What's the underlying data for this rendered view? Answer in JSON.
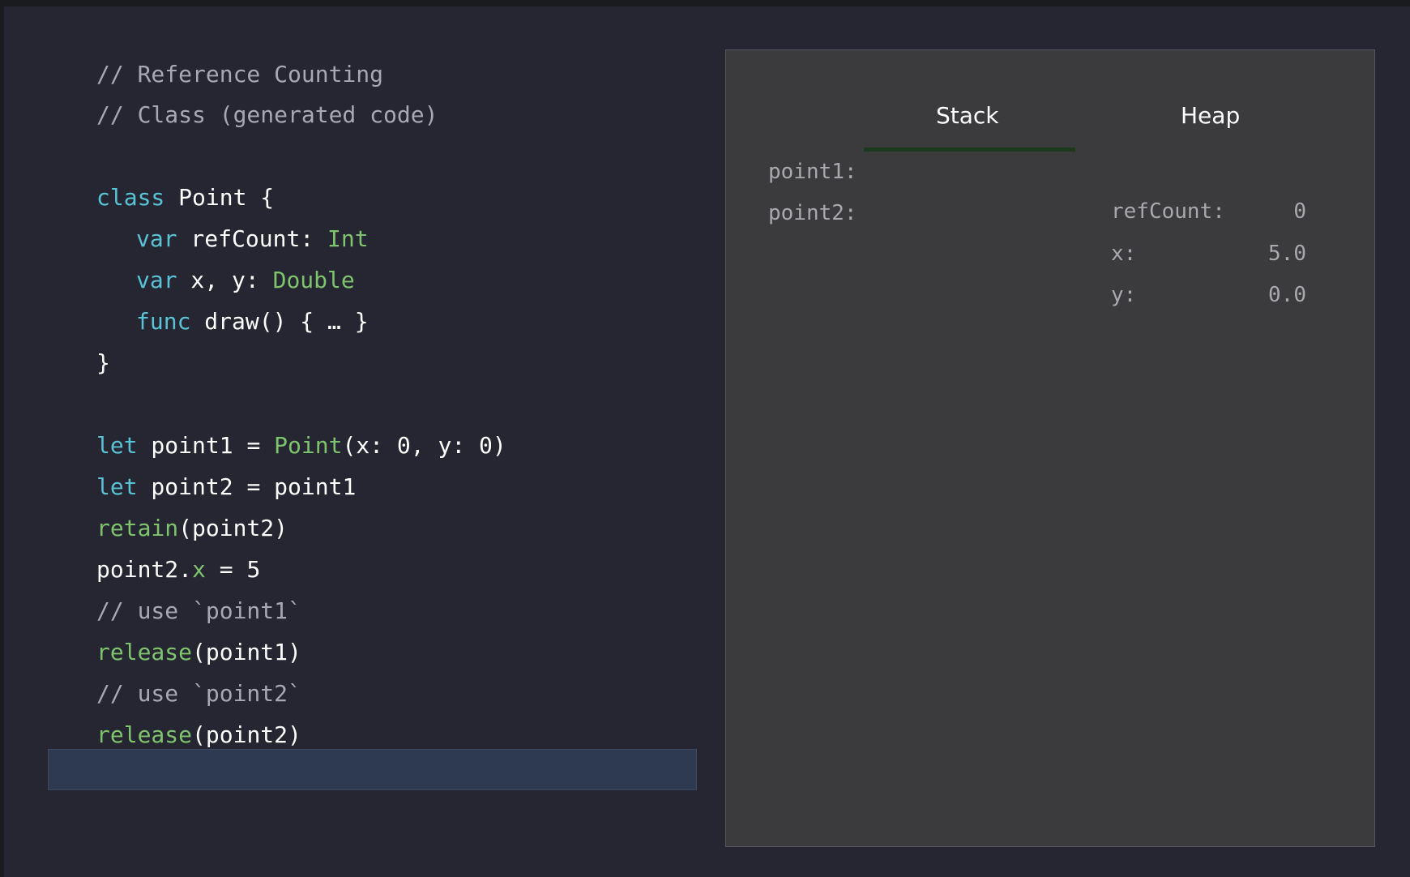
{
  "code": {
    "comment_title": "// Reference Counting",
    "comment_sub": "// Class (generated code)",
    "class_kw": "class",
    "class_name": " Point {",
    "var1_kw": "var",
    "var1_name": " refCount: ",
    "var1_type": "Int",
    "var2_kw": "var",
    "var2_name": " x, y: ",
    "var2_type": "Double",
    "func_kw": "func",
    "func_body": " draw() { … }",
    "close_brace": "}",
    "let1_kw": "let",
    "let1_mid": " point1 = ",
    "let1_type": "Point",
    "let1_args": "(x: 0, y: 0)",
    "let2_kw": "let",
    "let2_rest": " point2 = point1",
    "retain_fn": "retain",
    "retain_args": "(point2)",
    "assign_pre": "point2.",
    "assign_prop": "x",
    "assign_post": " = 5",
    "use1_comment": "// use `point1`",
    "release1_fn": "release",
    "release1_args": "(point1)",
    "use2_comment": "// use `point2`",
    "release2_fn": "release",
    "release2_args": "(point2)"
  },
  "memory": {
    "stack_title": "Stack",
    "heap_title": "Heap",
    "stack_vars": [
      {
        "label": "point1:"
      },
      {
        "label": "point2:"
      }
    ],
    "heap_fields": [
      {
        "label": "refCount:",
        "value": "0"
      },
      {
        "label": "x:",
        "value": "5.0"
      },
      {
        "label": "y:",
        "value": "0.0"
      }
    ]
  },
  "colors": {
    "background": "#252632",
    "keyword": "#59c2d4",
    "type": "#7ec46c",
    "comment": "#a7a8b3",
    "panel": "#3b3b3e",
    "highlight": "#2e3a4f"
  }
}
